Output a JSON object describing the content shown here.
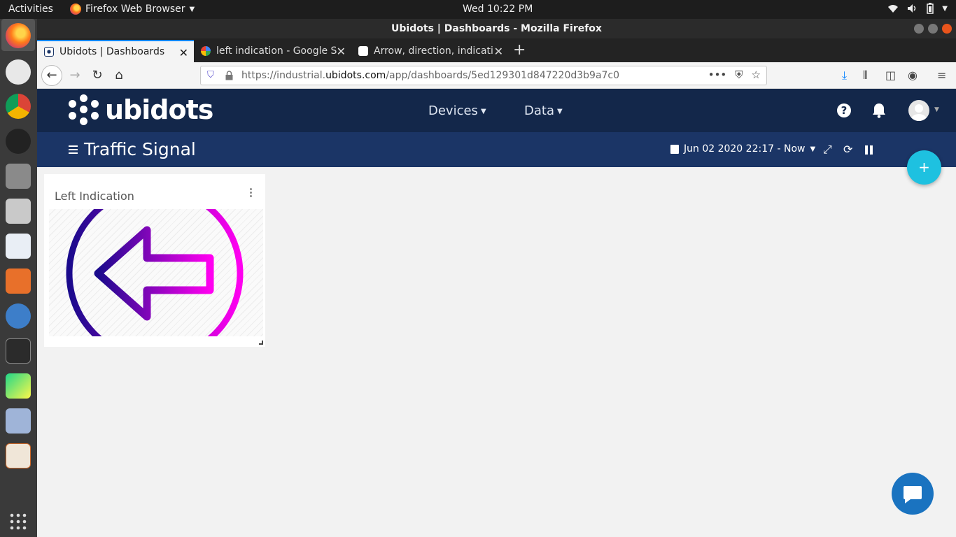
{
  "os": {
    "activities": "Activities",
    "app_name": "Firefox Web Browser",
    "clock": "Wed 10:22 PM"
  },
  "browser": {
    "window_title": "Ubidots | Dashboards - Mozilla Firefox",
    "tabs": [
      {
        "label": "Ubidots | Dashboards",
        "active": true
      },
      {
        "label": "left indication - Google S",
        "active": false
      },
      {
        "label": "Arrow, direction, indicati",
        "active": false
      }
    ],
    "url_prefix": "https://industrial.",
    "url_domain": "ubidots.com",
    "url_path": "/app/dashboards/5ed129301d847220d3b9a7c0"
  },
  "app": {
    "logo_text": "ubidots",
    "menu": [
      {
        "label": "Devices"
      },
      {
        "label": "Data"
      }
    ],
    "help_label": "?",
    "dashboard_title": "Traffic Signal",
    "date_range": "Jun 02 2020 22:17 - Now",
    "add_label": "+"
  },
  "widget": {
    "title": "Left Indication",
    "gradient_start": "#1a0a8c",
    "gradient_end": "#ff00f0"
  },
  "colors": {
    "header": "#13274a",
    "subheader": "#1b3566",
    "fab": "#1ec1e0",
    "chat": "#1a73c0"
  }
}
